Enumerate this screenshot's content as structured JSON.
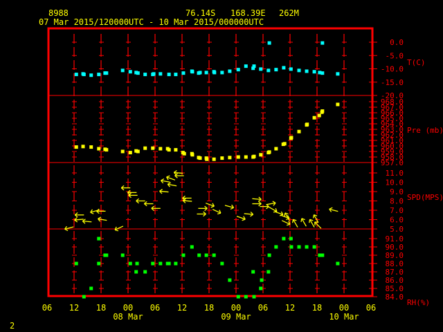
{
  "header": {
    "station_id": "8988",
    "latitude": "76.14S",
    "longitude": "168.39E",
    "elevation": "262M",
    "period": "07 Mar 2015/120000UTC - 10 Mar 2015/000000UTC"
  },
  "page_number": "2",
  "colors": {
    "text": "#ffff00",
    "axis": "#ff0000",
    "temperature": "#00ffff",
    "pressure": "#ffff00",
    "wind": "#ffff00",
    "rh": "#00ff00"
  },
  "chart_data": {
    "type": "scatter",
    "x_unit_hours_from_first_tick": true,
    "x_range_hours": [
      0,
      72
    ],
    "x_tick_labels": [
      "06",
      "12",
      "18",
      "00",
      "06",
      "12",
      "18",
      "00",
      "06",
      "12",
      "18",
      "00",
      "06"
    ],
    "date_labels": [
      {
        "hours": 18,
        "label": "08 Mar"
      },
      {
        "hours": 42,
        "label": "09 Mar"
      },
      {
        "hours": 66,
        "label": "10 Mar"
      }
    ],
    "panels": [
      {
        "name": "temperature",
        "ylabel": "T(C)",
        "ylim": [
          -20,
          0
        ],
        "ticks": [
          "0.0",
          "-5.0",
          "-10.0",
          "-15.0",
          "-20.0"
        ],
        "tick_values": [
          0,
          -5,
          -10,
          -15,
          -20
        ],
        "points": [
          [
            6.5,
            -12.1
          ],
          [
            8,
            -11.9
          ],
          [
            8.2,
            -12.1
          ],
          [
            9.8,
            -12.4
          ],
          [
            11.5,
            -12.1
          ],
          [
            12.9,
            -11.6
          ],
          [
            13.2,
            -11.6
          ],
          [
            16.8,
            -10.6
          ],
          [
            18.5,
            -11.1
          ],
          [
            19.8,
            -11.4
          ],
          [
            20.2,
            -11.6
          ],
          [
            21.8,
            -12.1
          ],
          [
            23.5,
            -12.1
          ],
          [
            23.7,
            -11.9
          ],
          [
            25.2,
            -11.9
          ],
          [
            27.1,
            -12.1
          ],
          [
            28.6,
            -12.1
          ],
          [
            30.3,
            -11.6
          ],
          [
            32.2,
            -10.9
          ],
          [
            32.3,
            -11.1
          ],
          [
            33.7,
            -11.6
          ],
          [
            34,
            -11.4
          ],
          [
            35.4,
            -11.4
          ],
          [
            37.1,
            -11.1
          ],
          [
            37.2,
            -11.4
          ],
          [
            38.9,
            -11.4
          ],
          [
            40.6,
            -10.9
          ],
          [
            42.5,
            -10.3
          ],
          [
            44.2,
            -9.0
          ],
          [
            45.8,
            -9.8
          ],
          [
            46,
            -9.0
          ],
          [
            47.5,
            -10.1
          ],
          [
            49.2,
            -10.6
          ],
          [
            49.4,
            -0.3
          ],
          [
            50.9,
            -10.3
          ],
          [
            52.6,
            -9.6
          ],
          [
            54.2,
            -10.1
          ],
          [
            56,
            -10.6
          ],
          [
            57.7,
            -10.9
          ],
          [
            59.4,
            -11.1
          ],
          [
            60.6,
            -11.4
          ],
          [
            61.2,
            -11.6
          ],
          [
            61.2,
            -0.3
          ],
          [
            64.6,
            -11.9
          ]
        ]
      },
      {
        "name": "pressure",
        "ylabel": "Pre (mb)",
        "ylim": [
          957,
          968
        ],
        "ticks": [
          "968.0",
          "967.0",
          "966.0",
          "965.0",
          "964.0",
          "963.0",
          "962.0",
          "961.0",
          "960.0",
          "959.0",
          "958.0",
          "957.0"
        ],
        "tick_values": [
          968,
          967,
          966,
          965,
          964,
          963,
          962,
          961,
          960,
          959,
          958,
          957
        ],
        "points": [
          [
            6.5,
            959.8
          ],
          [
            8,
            959.9
          ],
          [
            9.8,
            959.8
          ],
          [
            11.5,
            959.5
          ],
          [
            12.9,
            959.4
          ],
          [
            13.2,
            959.3
          ],
          [
            16.8,
            959.0
          ],
          [
            18.5,
            958.8
          ],
          [
            19.8,
            959.1
          ],
          [
            20.2,
            959.0
          ],
          [
            21.8,
            959.6
          ],
          [
            23.5,
            959.6
          ],
          [
            25.2,
            959.5
          ],
          [
            26.8,
            959.5
          ],
          [
            27.1,
            959.3
          ],
          [
            28.6,
            959.3
          ],
          [
            30.2,
            958.8
          ],
          [
            30.5,
            958.6
          ],
          [
            32.2,
            958.6
          ],
          [
            32.3,
            958.4
          ],
          [
            33.7,
            957.9
          ],
          [
            34,
            957.8
          ],
          [
            35.4,
            957.8
          ],
          [
            35.5,
            957.6
          ],
          [
            37.1,
            957.6
          ],
          [
            38.9,
            957.8
          ],
          [
            40.6,
            957.9
          ],
          [
            42.5,
            958.0
          ],
          [
            44.2,
            958.0
          ],
          [
            45.8,
            958.0
          ],
          [
            46,
            958.1
          ],
          [
            47.5,
            958.4
          ],
          [
            49.2,
            958.8
          ],
          [
            49.4,
            958.9
          ],
          [
            50.9,
            959.5
          ],
          [
            52.5,
            960.3
          ],
          [
            52.8,
            960.4
          ],
          [
            54.2,
            961.4
          ],
          [
            54.3,
            961.5
          ],
          [
            56,
            962.6
          ],
          [
            57.7,
            963.8
          ],
          [
            57.8,
            963.9
          ],
          [
            59.4,
            965.1
          ],
          [
            60.5,
            965.5
          ],
          [
            61.1,
            966.1
          ],
          [
            61.2,
            966.3
          ],
          [
            64.6,
            967.5
          ]
        ]
      },
      {
        "name": "wind",
        "ylabel": "SPD(MPS)",
        "ylim": [
          5,
          11
        ],
        "ticks": [
          "11.0",
          "10.0",
          "9.0",
          "8.0",
          "7.0",
          "6.0",
          "5.0"
        ],
        "tick_values": [
          11,
          10,
          9,
          8,
          7,
          6,
          5
        ],
        "arrows_hours_speed_bearing": [
          [
            4.9,
            5.1,
            255
          ],
          [
            7.2,
            6.5,
            270
          ],
          [
            7.1,
            6.0,
            265
          ],
          [
            8.9,
            5.8,
            275
          ],
          [
            10.6,
            6.9,
            255
          ],
          [
            12,
            6.9,
            270
          ],
          [
            12.3,
            6.0,
            280
          ],
          [
            16,
            5.1,
            245
          ],
          [
            17.5,
            9.4,
            270
          ],
          [
            18.9,
            8.9,
            270
          ],
          [
            19.1,
            8.6,
            270
          ],
          [
            20.8,
            8.0,
            270
          ],
          [
            22.6,
            7.7,
            270
          ],
          [
            24.2,
            7.2,
            270
          ],
          [
            26,
            9.0,
            275
          ],
          [
            26.3,
            10.1,
            280
          ],
          [
            27.5,
            10.4,
            290
          ],
          [
            27.8,
            9.7,
            280
          ],
          [
            29.2,
            11.0,
            275
          ],
          [
            29.4,
            10.7,
            270
          ],
          [
            31.1,
            8.3,
            270
          ],
          [
            31.2,
            8.0,
            275
          ],
          [
            34.3,
            6.6,
            90
          ],
          [
            34.6,
            7.2,
            90
          ],
          [
            36.2,
            7.6,
            110
          ],
          [
            37.7,
            6.9,
            115
          ],
          [
            40.5,
            7.4,
            105
          ],
          [
            43.1,
            6.2,
            110
          ],
          [
            44.8,
            6.6,
            95
          ],
          [
            46.6,
            8.2,
            95
          ],
          [
            46.6,
            7.7,
            90
          ],
          [
            48.3,
            7.4,
            90
          ],
          [
            49.8,
            7.7,
            80
          ],
          [
            50.2,
            7.1,
            120
          ],
          [
            51.5,
            6.7,
            110
          ],
          [
            52.9,
            6.3,
            110
          ],
          [
            53.1,
            5.7,
            115
          ],
          [
            53.4,
            6.3,
            330
          ],
          [
            55.2,
            5.6,
            330
          ],
          [
            57.1,
            5.7,
            330
          ],
          [
            58.9,
            5.6,
            330
          ],
          [
            59.8,
            6.1,
            330
          ],
          [
            60.2,
            5.4,
            315
          ],
          [
            63.7,
            7.0,
            285
          ]
        ]
      },
      {
        "name": "rh",
        "ylabel": "RH(%)",
        "ylim": [
          84,
          91
        ],
        "ticks": [
          "91.0",
          "90.0",
          "89.0",
          "88.0",
          "87.0",
          "86.0",
          "85.0",
          "84.0"
        ],
        "tick_values": [
          91,
          90,
          89,
          88,
          87,
          86,
          85,
          84
        ],
        "points": [
          [
            6.5,
            88
          ],
          [
            8.2,
            84
          ],
          [
            9.8,
            85
          ],
          [
            11.5,
            91
          ],
          [
            11.5,
            88
          ],
          [
            12.9,
            89
          ],
          [
            13.2,
            89
          ],
          [
            16.8,
            89
          ],
          [
            18.5,
            88
          ],
          [
            19.8,
            87
          ],
          [
            20,
            88
          ],
          [
            21.8,
            87
          ],
          [
            23.5,
            88
          ],
          [
            25.2,
            88
          ],
          [
            26.8,
            88
          ],
          [
            27.1,
            88
          ],
          [
            28.6,
            88
          ],
          [
            30.3,
            89
          ],
          [
            32.2,
            90
          ],
          [
            33.8,
            89
          ],
          [
            35.4,
            89
          ],
          [
            37.1,
            89
          ],
          [
            38.9,
            88
          ],
          [
            40.6,
            86
          ],
          [
            42.5,
            84
          ],
          [
            44.2,
            84
          ],
          [
            45.8,
            87
          ],
          [
            46,
            84
          ],
          [
            47.5,
            85
          ],
          [
            47.7,
            86
          ],
          [
            49.2,
            87
          ],
          [
            49.4,
            89
          ],
          [
            50.9,
            90
          ],
          [
            52.6,
            91
          ],
          [
            54.2,
            91
          ],
          [
            54.3,
            90
          ],
          [
            56,
            90
          ],
          [
            57.7,
            90
          ],
          [
            59.4,
            90
          ],
          [
            60.6,
            89
          ],
          [
            61.2,
            89
          ],
          [
            64.6,
            88
          ]
        ]
      }
    ]
  }
}
